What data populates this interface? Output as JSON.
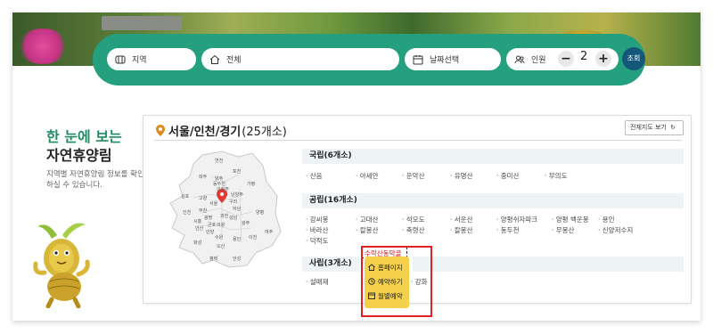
{
  "search": {
    "region": "지역",
    "all": "전체",
    "date": "날짜선택",
    "people_label": "인원",
    "people_count": "2",
    "submit": "조회"
  },
  "intro": {
    "title_line1": "한 눈에 보는",
    "title_line2": "자연휴양림",
    "description": "지역별 자연휴양림 정보를 확인하실 수 있습니다."
  },
  "panel": {
    "title": "서울/인천/경기",
    "count": "(25개소)",
    "map_button": "전체지도 보기"
  },
  "map_labels": [
    "연천",
    "포천",
    "파주",
    "양주",
    "가평",
    "동두천",
    "의정부",
    "남양주",
    "김포",
    "고양",
    "서울",
    "구리",
    "하남",
    "인천",
    "부천",
    "광명",
    "과천",
    "양평",
    "성남",
    "시흥",
    "안산",
    "군포",
    "의왕",
    "광주",
    "안양",
    "수원",
    "용인",
    "이천",
    "여주",
    "화성",
    "오산",
    "평택",
    "안성"
  ],
  "sections": {
    "national": {
      "title": "국립(6개소)",
      "items": [
        "산음",
        "아세안",
        "운악산",
        "유명산",
        "중미산",
        "무의도"
      ]
    },
    "public": {
      "title": "공립(16개소)",
      "items": [
        "강씨봉",
        "고대산",
        "석모도",
        "서운산",
        "양평쉬자파크",
        "양평 백운봉",
        "용인",
        "바라산",
        "칼봉산",
        "축령산",
        "칼봉산",
        "동두천",
        "무봉산",
        "신양저수지",
        "덕적도",
        "수락산동막골"
      ]
    },
    "private": {
      "title": "사립(3개소)",
      "items": [
        "설매재",
        "강화"
      ]
    }
  },
  "popup": {
    "homepage": "홈페이지",
    "reserve": "예약하기",
    "monthly": "월별예약"
  },
  "colors": {
    "accent_green": "#24a07e",
    "title_green": "#1f8c62",
    "submit_blue": "#15577a",
    "popup_yellow": "#f5d04a",
    "highlight_red": "#e02222"
  }
}
